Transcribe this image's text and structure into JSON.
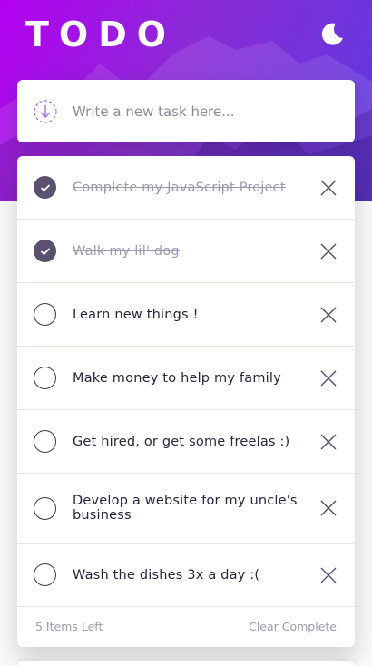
{
  "header": {
    "title": "TODO",
    "theme_icon": "moon-icon"
  },
  "new_task": {
    "icon": "add-task-icon",
    "placeholder": "Write a new task here..."
  },
  "tasks": [
    {
      "text": "Complete my JavaScript Project",
      "completed": true
    },
    {
      "text": "Walk my lil' dog",
      "completed": true
    },
    {
      "text": "Learn new things !",
      "completed": false
    },
    {
      "text": "Make money to help my family",
      "completed": false
    },
    {
      "text": "Get hired, or get some freelas :)",
      "completed": false
    },
    {
      "text": "Develop a website for my uncle's business",
      "completed": false
    },
    {
      "text": "Wash the dishes 3x a day :(",
      "completed": false
    }
  ],
  "footer": {
    "items_left": "5 Items Left",
    "clear_label": "Clear Complete"
  },
  "colors": {
    "gradient_start": "#b400f0",
    "gradient_end": "#5b3be0",
    "checked_fill": "#5a5070",
    "text": "#25273c",
    "muted": "#9b9baf"
  }
}
